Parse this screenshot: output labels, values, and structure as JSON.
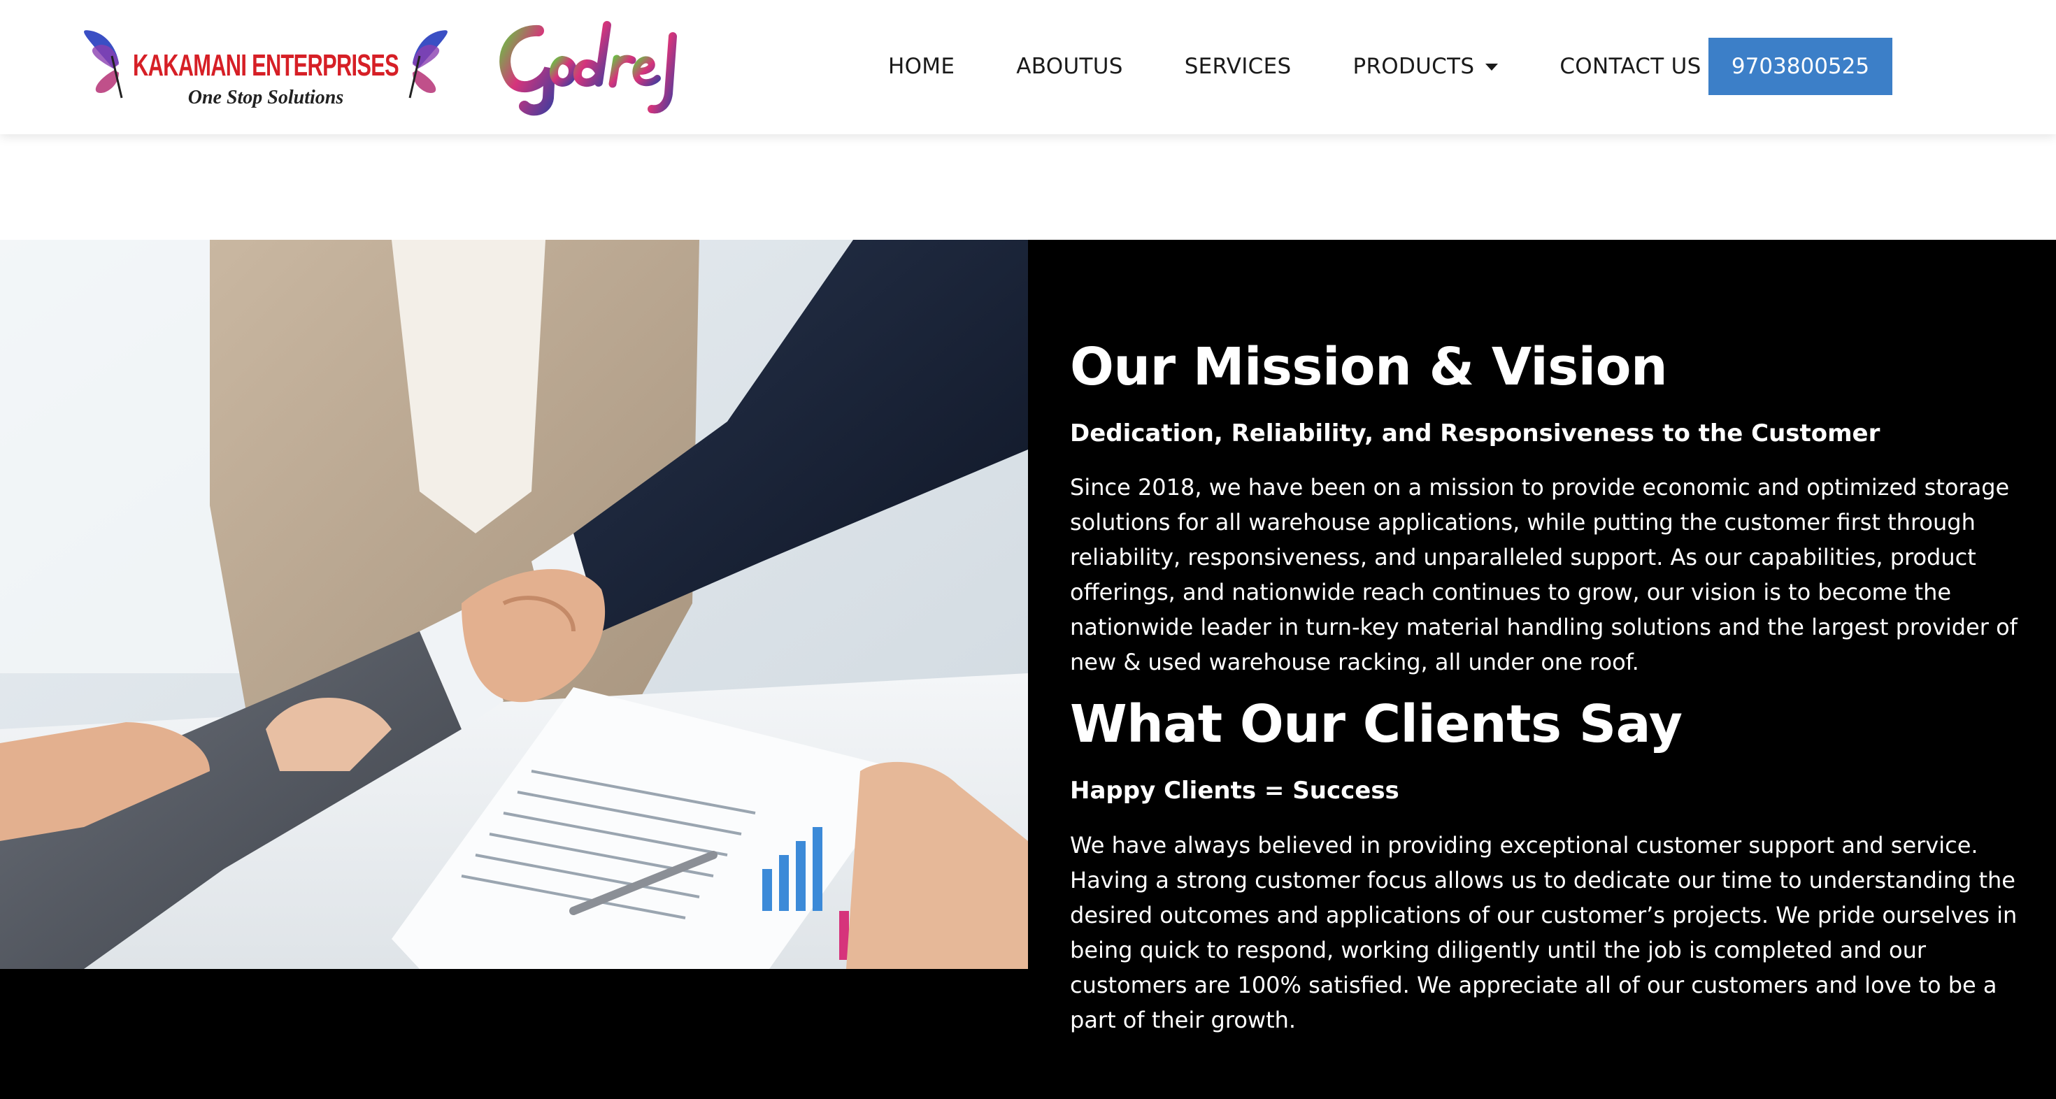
{
  "brand": {
    "name": "KAKAMANI ENTERPRISES",
    "tagline": "One Stop Solutions",
    "partner": "Godrej",
    "colors": {
      "brand_red": "#d61f26",
      "tagline_dark": "#222222",
      "butterfly_blue": "#3a4fc4",
      "butterfly_pink": "#c0508a"
    }
  },
  "nav": {
    "items": [
      {
        "label": "HOME"
      },
      {
        "label": "ABOUTUS"
      },
      {
        "label": "SERVICES"
      },
      {
        "label": "PRODUCTS",
        "has_dropdown": true
      },
      {
        "label": "CONTACT US"
      }
    ],
    "phone_label": "9703800525"
  },
  "colors": {
    "accent": "#3c7fc8",
    "section_bg": "#000000",
    "text_light": "#ffffff"
  },
  "main": {
    "photo_icon": "business-handshake-photo",
    "mission": {
      "title": "Our Mission & Vision",
      "subtitle": "Dedication, Reliability, and Responsiveness to the Customer",
      "body": "Since 2018, we have been on a mission to provide economic and optimized storage solutions for all warehouse applications, while putting the customer first through reliability, responsiveness, and unparalleled support. As our capabilities, product offerings, and nationwide reach continues to grow, our vision is to become the nationwide leader in turn-key material handling solutions and the largest provider of new & used warehouse racking, all under one roof."
    },
    "clients": {
      "title": "What Our Clients Say",
      "subtitle": "Happy Clients = Success",
      "body": "We have always believed in providing exceptional customer support and service. Having a strong customer focus allows us to dedicate our time to understanding the desired outcomes and applications of our customer’s projects. We pride ourselves in being quick to respond, working diligently until the job is completed and our customers are 100% satisfied. We appreciate all of our customers and love to be a part of their growth."
    }
  }
}
